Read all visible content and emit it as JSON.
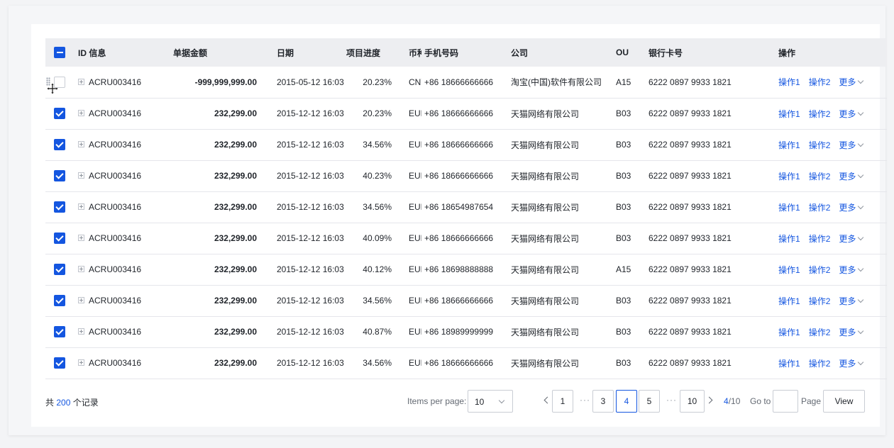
{
  "table": {
    "columns": {
      "id": "ID 信息",
      "amount": "单据金额",
      "date": "日期",
      "progress": "项目进度",
      "currency": "币种",
      "phone": "手机号码",
      "company": "公司",
      "ou": "OU",
      "card": "银行卡号",
      "actions": "操作"
    },
    "select_all_state": "indeterminate",
    "actions": {
      "op1": "操作1",
      "op2": "操作2",
      "more": "更多"
    },
    "rows": [
      {
        "checked": false,
        "id": "ACRU003416",
        "amount": "-999,999,999.00",
        "date": "2015-05-12 16:03",
        "progress": "20.23%",
        "currency": "CNY",
        "phone": "+86 18666666666",
        "company": "淘宝(中国)软件有限公司",
        "ou": "A15",
        "card": "6222 0897 9933 1821"
      },
      {
        "checked": true,
        "id": "ACRU003416",
        "amount": "232,299.00",
        "date": "2015-12-12 16:03",
        "progress": "20.23%",
        "currency": "EUR",
        "phone": "+86 18666666666",
        "company": "天猫网络有限公司",
        "ou": "B03",
        "card": "6222 0897 9933 1821"
      },
      {
        "checked": true,
        "id": "ACRU003416",
        "amount": "232,299.00",
        "date": "2015-12-12 16:03",
        "progress": "34.56%",
        "currency": "EUR",
        "phone": "+86 18666666666",
        "company": "天猫网络有限公司",
        "ou": "B03",
        "card": "6222 0897 9933 1821"
      },
      {
        "checked": true,
        "id": "ACRU003416",
        "amount": "232,299.00",
        "date": "2015-12-12 16:03",
        "progress": "40.23%",
        "currency": "EUR",
        "phone": "+86 18666666666",
        "company": "天猫网络有限公司",
        "ou": "B03",
        "card": "6222 0897 9933 1821"
      },
      {
        "checked": true,
        "id": "ACRU003416",
        "amount": "232,299.00",
        "date": "2015-12-12 16:03",
        "progress": "34.56%",
        "currency": "EUR",
        "phone": "+86 18654987654",
        "company": "天猫网络有限公司",
        "ou": "B03",
        "card": "6222 0897 9933 1821"
      },
      {
        "checked": true,
        "id": "ACRU003416",
        "amount": "232,299.00",
        "date": "2015-12-12 16:03",
        "progress": "40.09%",
        "currency": "EUR",
        "phone": "+86 18666666666",
        "company": "天猫网络有限公司",
        "ou": "B03",
        "card": "6222 0897 9933 1821"
      },
      {
        "checked": true,
        "id": "ACRU003416",
        "amount": "232,299.00",
        "date": "2015-12-12 16:03",
        "progress": "40.12%",
        "currency": "EUR",
        "phone": "+86 18698888888",
        "company": "天猫网络有限公司",
        "ou": "A15",
        "card": "6222 0897 9933 1821"
      },
      {
        "checked": true,
        "id": "ACRU003416",
        "amount": "232,299.00",
        "date": "2015-12-12 16:03",
        "progress": "34.56%",
        "currency": "EUR",
        "phone": "+86 18666666666",
        "company": "天猫网络有限公司",
        "ou": "B03",
        "card": "6222 0897 9933 1821"
      },
      {
        "checked": true,
        "id": "ACRU003416",
        "amount": "232,299.00",
        "date": "2015-12-12 16:03",
        "progress": "40.87%",
        "currency": "EUR",
        "phone": "+86 18989999999",
        "company": "天猫网络有限公司",
        "ou": "B03",
        "card": "6222 0897 9933 1821"
      },
      {
        "checked": true,
        "id": "ACRU003416",
        "amount": "232,299.00",
        "date": "2015-12-12 16:03",
        "progress": "34.56%",
        "currency": "EUR",
        "phone": "+86 18666666666",
        "company": "天猫网络有限公司",
        "ou": "B03",
        "card": "6222 0897 9933 1821"
      }
    ]
  },
  "footer": {
    "total_prefix": "共",
    "total_count": "200",
    "total_suffix": "个记录",
    "items_per_page_label": "Items per page:",
    "items_per_page_value": "10",
    "pages": {
      "p1": "1",
      "p3": "3",
      "p4": "4",
      "p5": "5",
      "p10": "10",
      "ellipsis": "···"
    },
    "current_page": "4",
    "total_pages": "/10",
    "goto_label": "Go to",
    "goto_value": "",
    "page_label": "Page",
    "view_label": "View"
  },
  "colors": {
    "accent": "#1456e0",
    "header_bg": "#edeef1",
    "page_bg": "#f3f4f6"
  },
  "icons": [
    "checkbox",
    "expand-plus-icon",
    "drag-handle-icon",
    "move-cursor-icon",
    "chevron-down-icon",
    "chevron-left-icon",
    "chevron-right-icon"
  ]
}
